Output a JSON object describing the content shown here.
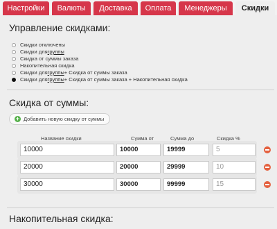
{
  "tabs": [
    {
      "label": "Настройки",
      "active": false
    },
    {
      "label": "Валюты",
      "active": false
    },
    {
      "label": "Доставка",
      "active": false
    },
    {
      "label": "Оплата",
      "active": false
    },
    {
      "label": "Менеджеры",
      "active": false
    },
    {
      "label": "Скидки",
      "active": true
    }
  ],
  "discount_mode": {
    "title": "Управление скидками:",
    "options": [
      {
        "parts": [
          "Скидки отключены"
        ],
        "checked": false
      },
      {
        "parts": [
          "Скидки для ",
          "группы"
        ],
        "checked": false
      },
      {
        "parts": [
          "Скидка от суммы заказа"
        ],
        "checked": false
      },
      {
        "parts": [
          "Накопительная скидка"
        ],
        "checked": false
      },
      {
        "parts": [
          "Скидки для ",
          "группы",
          " + Скидка от суммы заказа"
        ],
        "checked": false
      },
      {
        "parts": [
          "Скидки для ",
          "группы",
          " + Скидка от суммы заказа + Накопительная скидка"
        ],
        "checked": true
      }
    ]
  },
  "amount_discount": {
    "title": "Скидка от суммы:",
    "add_button_label": "Добавить новую скидку от суммы",
    "columns": [
      "Название скидки",
      "Сумма от",
      "Сумма до",
      "Скидка %"
    ],
    "rows": [
      {
        "name": "10000",
        "from": "10000",
        "to": "19999",
        "percent": "5"
      },
      {
        "name": "20000",
        "from": "20000",
        "to": "29999",
        "percent": "10"
      },
      {
        "name": "30000",
        "from": "30000",
        "to": "99999",
        "percent": "15"
      }
    ]
  },
  "cumulative_discount": {
    "title": "Накопительная скидка:"
  },
  "colors": {
    "tab_red": "#d6364a",
    "tab_active": "#eeeeee",
    "add_green": "#55b04a",
    "delete_orange": "#e4603e"
  }
}
